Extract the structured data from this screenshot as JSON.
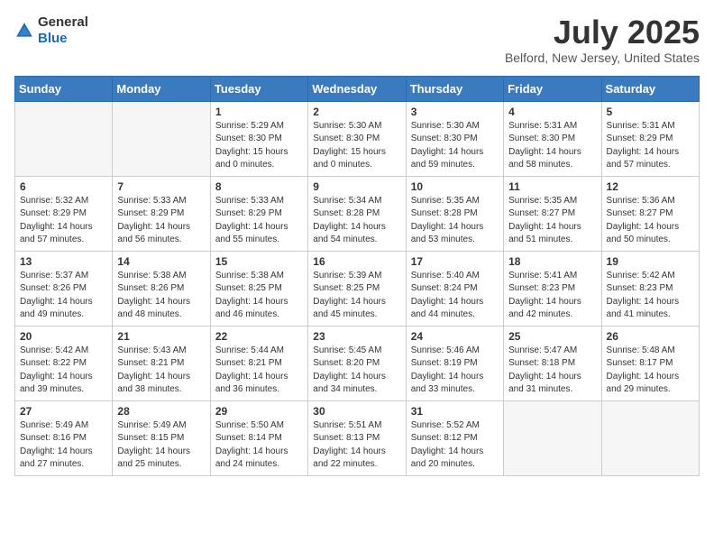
{
  "header": {
    "logo_general": "General",
    "logo_blue": "Blue",
    "month_title": "July 2025",
    "location": "Belford, New Jersey, United States"
  },
  "days_of_week": [
    "Sunday",
    "Monday",
    "Tuesday",
    "Wednesday",
    "Thursday",
    "Friday",
    "Saturday"
  ],
  "weeks": [
    [
      {
        "day": "",
        "info": ""
      },
      {
        "day": "",
        "info": ""
      },
      {
        "day": "1",
        "info": "Sunrise: 5:29 AM\nSunset: 8:30 PM\nDaylight: 15 hours\nand 0 minutes."
      },
      {
        "day": "2",
        "info": "Sunrise: 5:30 AM\nSunset: 8:30 PM\nDaylight: 15 hours\nand 0 minutes."
      },
      {
        "day": "3",
        "info": "Sunrise: 5:30 AM\nSunset: 8:30 PM\nDaylight: 14 hours\nand 59 minutes."
      },
      {
        "day": "4",
        "info": "Sunrise: 5:31 AM\nSunset: 8:30 PM\nDaylight: 14 hours\nand 58 minutes."
      },
      {
        "day": "5",
        "info": "Sunrise: 5:31 AM\nSunset: 8:29 PM\nDaylight: 14 hours\nand 57 minutes."
      }
    ],
    [
      {
        "day": "6",
        "info": "Sunrise: 5:32 AM\nSunset: 8:29 PM\nDaylight: 14 hours\nand 57 minutes."
      },
      {
        "day": "7",
        "info": "Sunrise: 5:33 AM\nSunset: 8:29 PM\nDaylight: 14 hours\nand 56 minutes."
      },
      {
        "day": "8",
        "info": "Sunrise: 5:33 AM\nSunset: 8:29 PM\nDaylight: 14 hours\nand 55 minutes."
      },
      {
        "day": "9",
        "info": "Sunrise: 5:34 AM\nSunset: 8:28 PM\nDaylight: 14 hours\nand 54 minutes."
      },
      {
        "day": "10",
        "info": "Sunrise: 5:35 AM\nSunset: 8:28 PM\nDaylight: 14 hours\nand 53 minutes."
      },
      {
        "day": "11",
        "info": "Sunrise: 5:35 AM\nSunset: 8:27 PM\nDaylight: 14 hours\nand 51 minutes."
      },
      {
        "day": "12",
        "info": "Sunrise: 5:36 AM\nSunset: 8:27 PM\nDaylight: 14 hours\nand 50 minutes."
      }
    ],
    [
      {
        "day": "13",
        "info": "Sunrise: 5:37 AM\nSunset: 8:26 PM\nDaylight: 14 hours\nand 49 minutes."
      },
      {
        "day": "14",
        "info": "Sunrise: 5:38 AM\nSunset: 8:26 PM\nDaylight: 14 hours\nand 48 minutes."
      },
      {
        "day": "15",
        "info": "Sunrise: 5:38 AM\nSunset: 8:25 PM\nDaylight: 14 hours\nand 46 minutes."
      },
      {
        "day": "16",
        "info": "Sunrise: 5:39 AM\nSunset: 8:25 PM\nDaylight: 14 hours\nand 45 minutes."
      },
      {
        "day": "17",
        "info": "Sunrise: 5:40 AM\nSunset: 8:24 PM\nDaylight: 14 hours\nand 44 minutes."
      },
      {
        "day": "18",
        "info": "Sunrise: 5:41 AM\nSunset: 8:23 PM\nDaylight: 14 hours\nand 42 minutes."
      },
      {
        "day": "19",
        "info": "Sunrise: 5:42 AM\nSunset: 8:23 PM\nDaylight: 14 hours\nand 41 minutes."
      }
    ],
    [
      {
        "day": "20",
        "info": "Sunrise: 5:42 AM\nSunset: 8:22 PM\nDaylight: 14 hours\nand 39 minutes."
      },
      {
        "day": "21",
        "info": "Sunrise: 5:43 AM\nSunset: 8:21 PM\nDaylight: 14 hours\nand 38 minutes."
      },
      {
        "day": "22",
        "info": "Sunrise: 5:44 AM\nSunset: 8:21 PM\nDaylight: 14 hours\nand 36 minutes."
      },
      {
        "day": "23",
        "info": "Sunrise: 5:45 AM\nSunset: 8:20 PM\nDaylight: 14 hours\nand 34 minutes."
      },
      {
        "day": "24",
        "info": "Sunrise: 5:46 AM\nSunset: 8:19 PM\nDaylight: 14 hours\nand 33 minutes."
      },
      {
        "day": "25",
        "info": "Sunrise: 5:47 AM\nSunset: 8:18 PM\nDaylight: 14 hours\nand 31 minutes."
      },
      {
        "day": "26",
        "info": "Sunrise: 5:48 AM\nSunset: 8:17 PM\nDaylight: 14 hours\nand 29 minutes."
      }
    ],
    [
      {
        "day": "27",
        "info": "Sunrise: 5:49 AM\nSunset: 8:16 PM\nDaylight: 14 hours\nand 27 minutes."
      },
      {
        "day": "28",
        "info": "Sunrise: 5:49 AM\nSunset: 8:15 PM\nDaylight: 14 hours\nand 25 minutes."
      },
      {
        "day": "29",
        "info": "Sunrise: 5:50 AM\nSunset: 8:14 PM\nDaylight: 14 hours\nand 24 minutes."
      },
      {
        "day": "30",
        "info": "Sunrise: 5:51 AM\nSunset: 8:13 PM\nDaylight: 14 hours\nand 22 minutes."
      },
      {
        "day": "31",
        "info": "Sunrise: 5:52 AM\nSunset: 8:12 PM\nDaylight: 14 hours\nand 20 minutes."
      },
      {
        "day": "",
        "info": ""
      },
      {
        "day": "",
        "info": ""
      }
    ]
  ]
}
